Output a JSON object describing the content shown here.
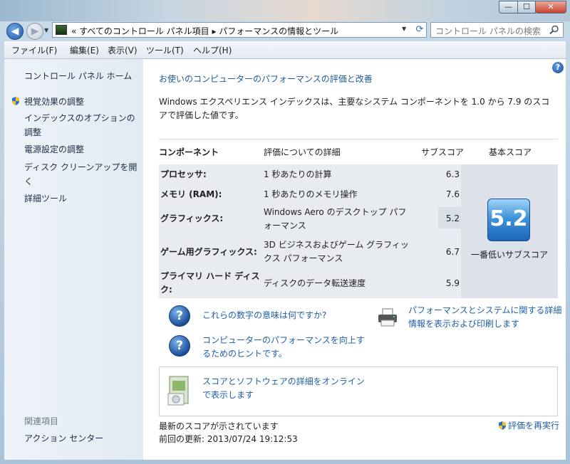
{
  "address": {
    "breadcrumb": "«  すべてのコントロール パネル項目  ▸  パフォーマンスの情報とツール",
    "search_placeholder": "コントロール パネルの検索"
  },
  "window_controls": {
    "minimize": "—",
    "maximize": "☐",
    "close": "✕"
  },
  "menu": [
    "ファイル(F)",
    "編集(E)",
    "表示(V)",
    "ツール(T)",
    "ヘルプ(H)"
  ],
  "sidebar": {
    "home": "コントロール パネル ホーム",
    "items": [
      "視覚効果の調整",
      "インデックスのオプションの調整",
      "電源設定の調整",
      "ディスク クリーンアップを開く",
      "詳細ツール"
    ],
    "related_header": "関連項目",
    "related": [
      "アクション センター"
    ]
  },
  "main": {
    "title": "お使いのコンピューターのパフォーマンスの評価と改善",
    "intro": "Windows エクスペリエンス インデックスは、主要なシステム コンポーネントを 1.0 から 7.9 のスコアで評価した値です。",
    "table": {
      "headers": {
        "component": "コンポーネント",
        "detail": "評価についての詳細",
        "subscore": "サブスコア",
        "base": "基本スコア"
      },
      "rows": [
        {
          "component": "プロセッサ:",
          "detail": "1 秒あたりの計算",
          "score": "6.3"
        },
        {
          "component": "メモリ (RAM):",
          "detail": "1 秒あたりのメモリ操作",
          "score": "7.6"
        },
        {
          "component": "グラフィックス:",
          "detail": "Windows Aero のデスクトップ パフォーマンス",
          "score": "5.2"
        },
        {
          "component": "ゲーム用グラフィックス:",
          "detail": "3D ビジネスおよびゲーム グラフィックス パフォーマンス",
          "score": "6.7"
        },
        {
          "component": "プライマリ ハード ディスク:",
          "detail": "ディスクのデータ転送速度",
          "score": "5.9"
        }
      ],
      "base_score": "5.2",
      "base_label": "一番低いサブスコア"
    },
    "links": {
      "meaning": "これらの数字の意味は何ですか?",
      "tips": "コンピューターのパフォーマンスを向上するためのヒントです。",
      "print": "パフォーマンスとシステムに関する詳細情報を表示および印刷します",
      "online": "スコアとソフトウェアの詳細をオンラインで表示します",
      "rerun": "評価を再実行"
    },
    "status": {
      "latest": "最新のスコアが示されています",
      "last_update": "前回の更新: 2013/07/24 19:12:53"
    }
  },
  "colors": {
    "link": "#1d5fa8",
    "badge": "#3f95d9",
    "sidebar": "#e8eef5"
  }
}
